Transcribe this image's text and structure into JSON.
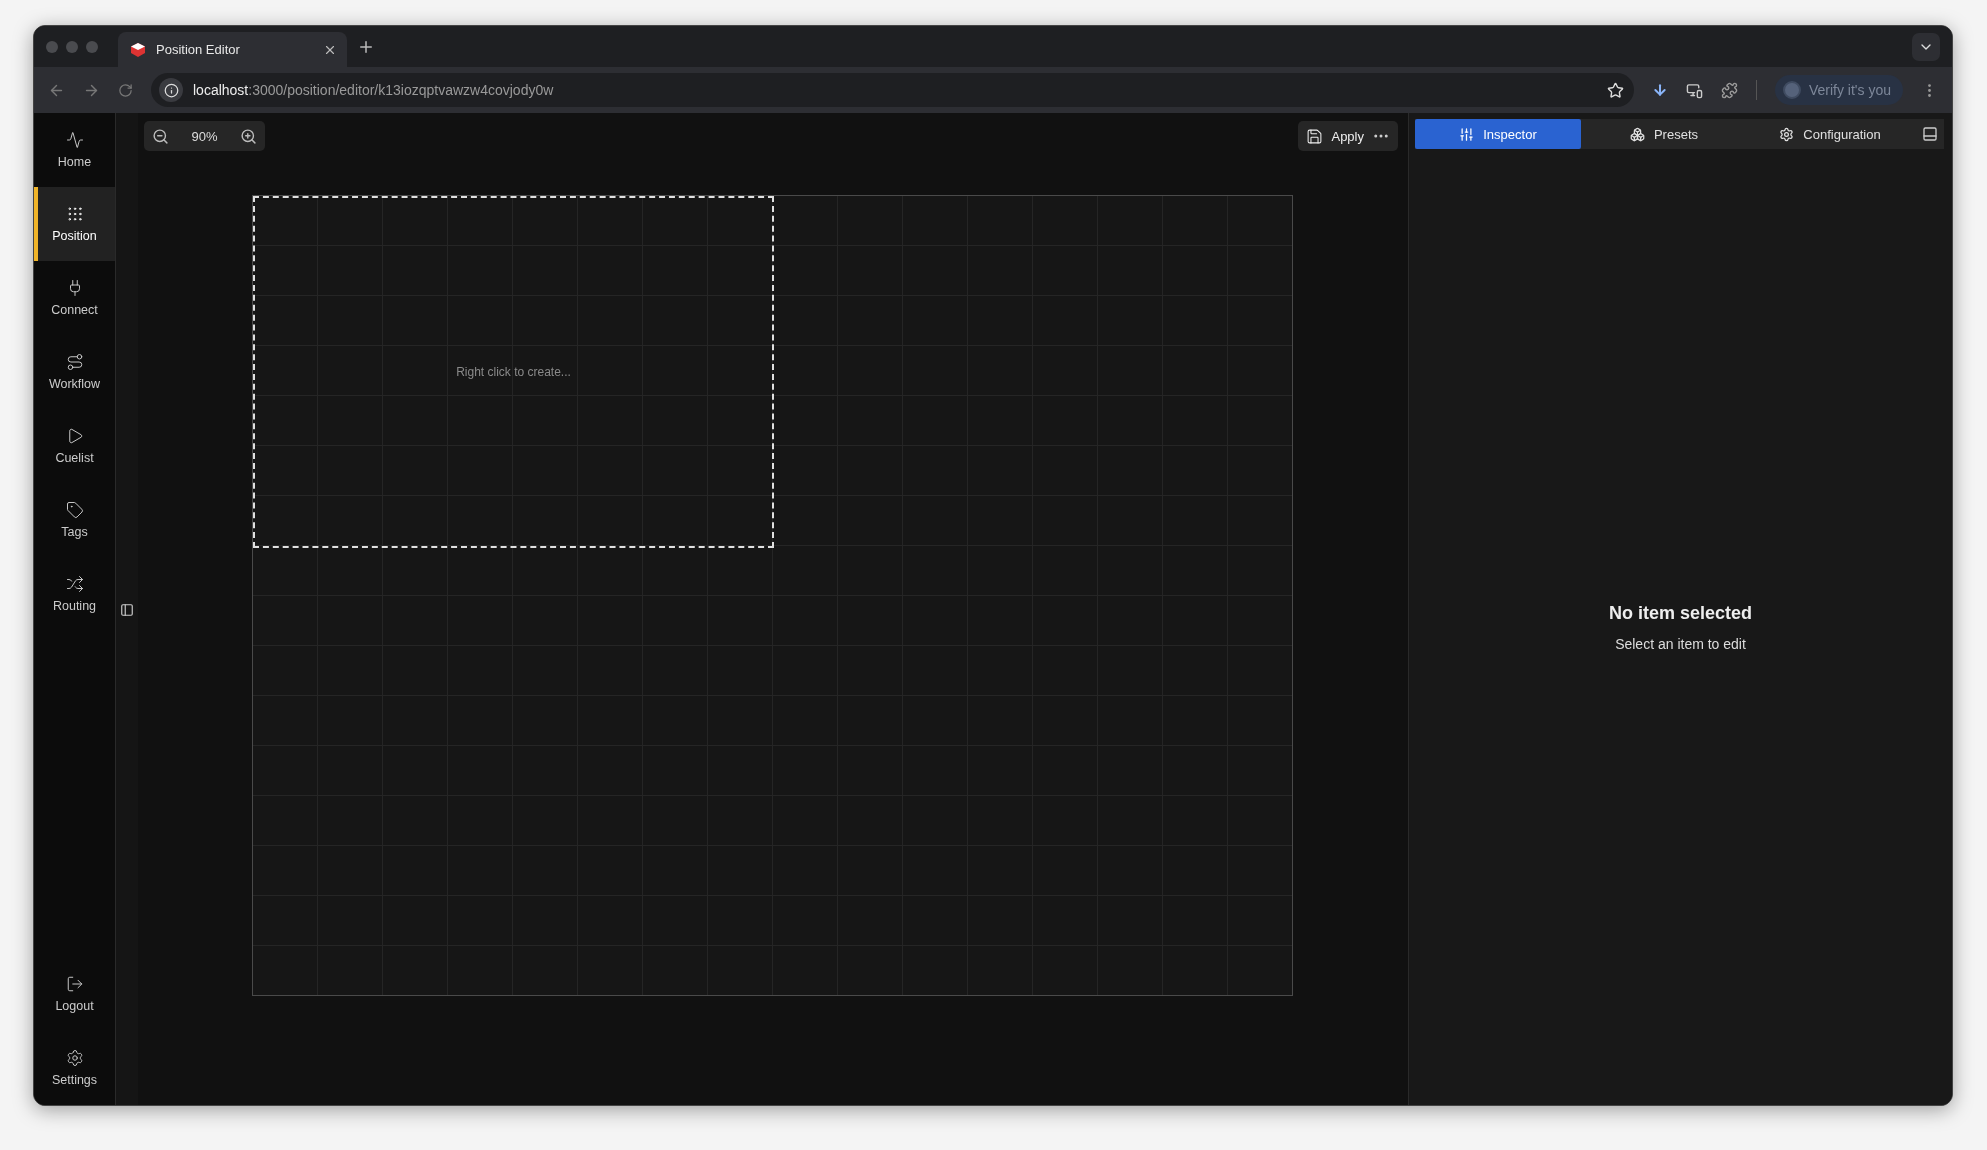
{
  "browser": {
    "tab_title": "Position Editor",
    "url_host": "localhost",
    "url_path": ":3000/position/editor/k13iozqptvawzw4covjody0w",
    "profile_button": "Verify it's you"
  },
  "sidebar": {
    "items": [
      {
        "label": "Home",
        "selected": false
      },
      {
        "label": "Position",
        "selected": true
      },
      {
        "label": "Connect",
        "selected": false
      },
      {
        "label": "Workflow",
        "selected": false
      },
      {
        "label": "Cuelist",
        "selected": false
      },
      {
        "label": "Tags",
        "selected": false
      },
      {
        "label": "Routing",
        "selected": false
      }
    ],
    "bottom_items": [
      {
        "label": "Logout",
        "selected": false
      },
      {
        "label": "Settings",
        "selected": false
      }
    ]
  },
  "toolbar": {
    "zoom": "90%",
    "apply_button": "Apply"
  },
  "canvas": {
    "hint": "Right click to create..."
  },
  "panel": {
    "tabs": [
      {
        "label": "Inspector",
        "selected": true
      },
      {
        "label": "Presets",
        "selected": false
      },
      {
        "label": "Configuration",
        "selected": false
      }
    ],
    "empty_title": "No item selected",
    "empty_subtitle": "Select an item to edit"
  }
}
